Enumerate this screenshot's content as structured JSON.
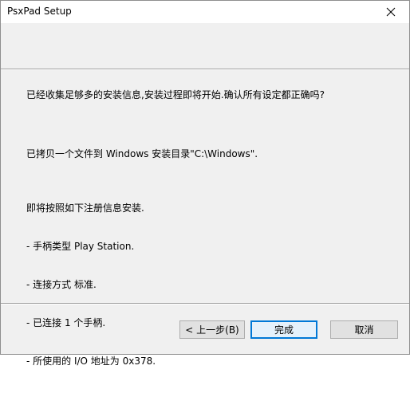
{
  "window": {
    "title": "PsxPad Setup"
  },
  "message": {
    "confirm": "已经收集足够多的安装信息,安装过程即将开始.确认所有设定都正确吗?",
    "copy_info": "已拷贝一个文件到 Windows 安装目录\"C:\\Windows\".",
    "install_intro": "即将按照如下注册信息安装.",
    "details": [
      "- 手柄类型 Play Station.",
      "- 连接方式 标准.",
      "- 已连接 1 个手柄.",
      "- 所使用的 I/O 地址为 0x378."
    ]
  },
  "buttons": {
    "back": "< 上一步(B)",
    "finish": "完成",
    "cancel": "取消"
  },
  "icons": {
    "close": "close-icon"
  }
}
